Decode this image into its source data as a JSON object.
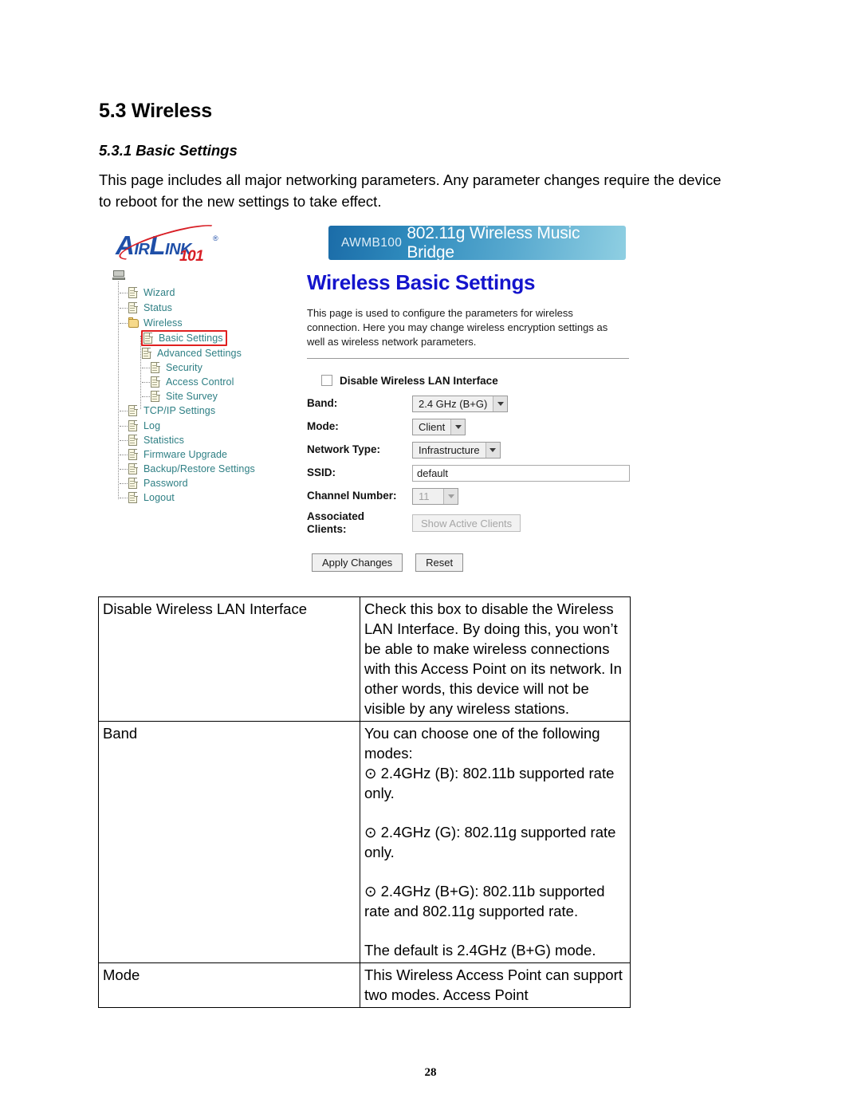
{
  "document": {
    "section_number_title": "5.3 Wireless",
    "subsection_title": "5.3.1 Basic Settings",
    "intro_paragraph": "This page includes all major networking parameters. Any parameter changes require the device to reboot for the new settings to take effect.",
    "page_number": "28"
  },
  "screenshot": {
    "logo": {
      "word_a": "A",
      "word_ir": "IR",
      "word_l": "L",
      "word_ink": "INK",
      "registered": "®",
      "number": "101"
    },
    "banner": {
      "model": "AWMB100",
      "title": "802.11g Wireless Music Bridge",
      "gradient_start": "#1b6ca8",
      "gradient_end": "#8fcfe2"
    },
    "tree": {
      "items": [
        {
          "label": "Wizard",
          "icon": "page-icon",
          "level": 1,
          "highlighted": false
        },
        {
          "label": "Status",
          "icon": "page-icon",
          "level": 1,
          "highlighted": false
        },
        {
          "label": "Wireless",
          "icon": "folder-open-icon",
          "level": 1,
          "highlighted": false
        },
        {
          "label": "Basic Settings",
          "icon": "page-icon",
          "level": 2,
          "highlighted": true
        },
        {
          "label": "Advanced Settings",
          "icon": "page-icon",
          "level": 2,
          "highlighted": false
        },
        {
          "label": "Security",
          "icon": "page-icon",
          "level": 2,
          "highlighted": false
        },
        {
          "label": "Access Control",
          "icon": "page-icon",
          "level": 2,
          "highlighted": false
        },
        {
          "label": "Site Survey",
          "icon": "page-icon",
          "level": 2,
          "highlighted": false
        },
        {
          "label": "TCP/IP Settings",
          "icon": "page-icon",
          "level": 1,
          "highlighted": false
        },
        {
          "label": "Log",
          "icon": "page-icon",
          "level": 1,
          "highlighted": false
        },
        {
          "label": "Statistics",
          "icon": "page-icon",
          "level": 1,
          "highlighted": false
        },
        {
          "label": "Firmware Upgrade",
          "icon": "page-icon",
          "level": 1,
          "highlighted": false
        },
        {
          "label": "Backup/Restore Settings",
          "icon": "page-icon",
          "level": 1,
          "highlighted": false
        },
        {
          "label": "Password",
          "icon": "page-icon",
          "level": 1,
          "highlighted": false
        },
        {
          "label": "Logout",
          "icon": "page-icon",
          "level": 1,
          "highlighted": false
        }
      ],
      "link_color": "#2e7f84",
      "highlight_color": "#e02020"
    },
    "panel": {
      "title": "Wireless Basic Settings",
      "title_color": "#1414cc",
      "description": "This page is used to configure the parameters for wireless connection. Here you may change wireless encryption settings as well as wireless network parameters.",
      "disable_checkbox_label": "Disable Wireless LAN Interface",
      "disable_checkbox_checked": false,
      "fields": {
        "band_label": "Band:",
        "band_value": "2.4 GHz (B+G)",
        "mode_label": "Mode:",
        "mode_value": "Client",
        "network_type_label": "Network Type:",
        "network_type_value": "Infrastructure",
        "ssid_label": "SSID:",
        "ssid_value": "default",
        "channel_label": "Channel Number:",
        "channel_value": "11",
        "associated_clients_label_line1": "Associated",
        "associated_clients_label_line2": "Clients:",
        "show_active_clients_button": "Show Active Clients"
      },
      "buttons": {
        "apply": "Apply Changes",
        "reset": "Reset"
      }
    }
  },
  "table": {
    "rows": [
      {
        "term": "Disable Wireless LAN Interface",
        "description": "Check this box to disable the Wireless LAN Interface. By doing this, you won’t be able to make wireless connections with this Access Point on its network. In other words, this device will not be visible by any wireless stations."
      },
      {
        "term": "Band",
        "desc_intro": "You can choose one of the following modes:",
        "desc_b": "⊙  2.4GHz (B): 802.11b supported rate only.",
        "desc_g": "⊙ 2.4GHz (G): 802.11g supported rate only.",
        "desc_bg": "⊙ 2.4GHz (B+G): 802.11b supported rate and 802.11g supported rate.",
        "desc_default": "The default is 2.4GHz (B+G) mode."
      },
      {
        "term": "Mode",
        "description": "This Wireless Access Point can support two modes.  Access Point"
      }
    ]
  }
}
